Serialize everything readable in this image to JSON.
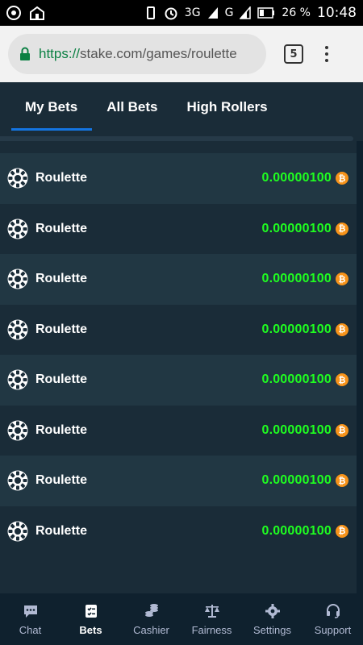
{
  "status_bar": {
    "network": "3G",
    "network_small": "3G",
    "carrier_g": "G",
    "battery": "26 %",
    "time": "10:48"
  },
  "browser": {
    "url_scheme": "https://",
    "url_rest": "stake.com/games/roulette",
    "tab_count": "5"
  },
  "tabs": [
    {
      "label": "My Bets",
      "active": true
    },
    {
      "label": "All Bets",
      "active": false
    },
    {
      "label": "High Rollers",
      "active": false
    }
  ],
  "bets": [
    {
      "game": "Roulette",
      "amount": "0.00000100",
      "currency_icon": "bitcoin-icon"
    },
    {
      "game": "Roulette",
      "amount": "0.00000100",
      "currency_icon": "bitcoin-icon"
    },
    {
      "game": "Roulette",
      "amount": "0.00000100",
      "currency_icon": "bitcoin-icon"
    },
    {
      "game": "Roulette",
      "amount": "0.00000100",
      "currency_icon": "bitcoin-icon"
    },
    {
      "game": "Roulette",
      "amount": "0.00000100",
      "currency_icon": "bitcoin-icon"
    },
    {
      "game": "Roulette",
      "amount": "0.00000100",
      "currency_icon": "bitcoin-icon"
    },
    {
      "game": "Roulette",
      "amount": "0.00000100",
      "currency_icon": "bitcoin-icon"
    },
    {
      "game": "Roulette",
      "amount": "0.00000100",
      "currency_icon": "bitcoin-icon"
    }
  ],
  "bottom_nav": [
    {
      "label": "Chat",
      "icon": "chat-icon",
      "active": false
    },
    {
      "label": "Bets",
      "icon": "bets-icon",
      "active": true
    },
    {
      "label": "Cashier",
      "icon": "cashier-icon",
      "active": false
    },
    {
      "label": "Fairness",
      "icon": "scale-icon",
      "active": false
    },
    {
      "label": "Settings",
      "icon": "gear-icon",
      "active": false
    },
    {
      "label": "Support",
      "icon": "headset-icon",
      "active": false
    }
  ],
  "colors": {
    "background": "#1a2c38",
    "row_alt": "#213743",
    "nav_bg": "#0f212e",
    "accent": "#1475e1",
    "win_green": "#1fff20",
    "bitcoin": "#f7931a"
  }
}
